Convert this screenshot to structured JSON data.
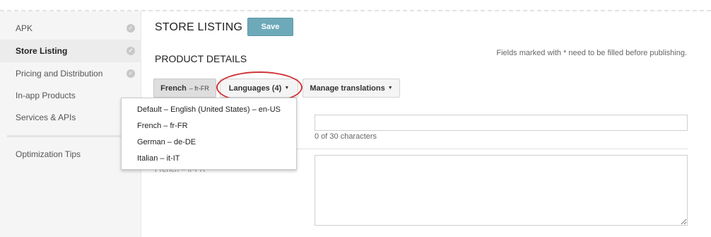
{
  "sidebar": {
    "items": [
      {
        "label": "APK",
        "checked": true
      },
      {
        "label": "Store Listing",
        "checked": true,
        "active": true
      },
      {
        "label": "Pricing and Distribution",
        "checked": true
      },
      {
        "label": "In-app Products",
        "checked": false
      },
      {
        "label": "Services & APIs",
        "checked": false
      }
    ],
    "secondary": {
      "label": "Optimization Tips"
    }
  },
  "header": {
    "title": "STORE LISTING",
    "save_label": "Save"
  },
  "product": {
    "section_title": "PRODUCT DETAILS",
    "required_note": "Fields marked with * need to be filled before publishing."
  },
  "toolbar": {
    "french_label": "French",
    "french_code": "– fr-FR",
    "languages_label": "Languages (4)",
    "manage_label": "Manage translations"
  },
  "languages_menu": [
    "Default – English (United States) – en-US",
    "French – fr-FR",
    "German – de-DE",
    "Italian – it-IT"
  ],
  "form": {
    "title_counter": "0 of 30 characters",
    "description_lang_label": "French – fr-FR"
  },
  "colors": {
    "save_button": "#6ea9b9",
    "highlight_ring": "#d03538",
    "sidebar_bg": "#f5f5f5"
  },
  "icons": {
    "check": "check-circle-icon",
    "caret": "caret-down-icon"
  }
}
